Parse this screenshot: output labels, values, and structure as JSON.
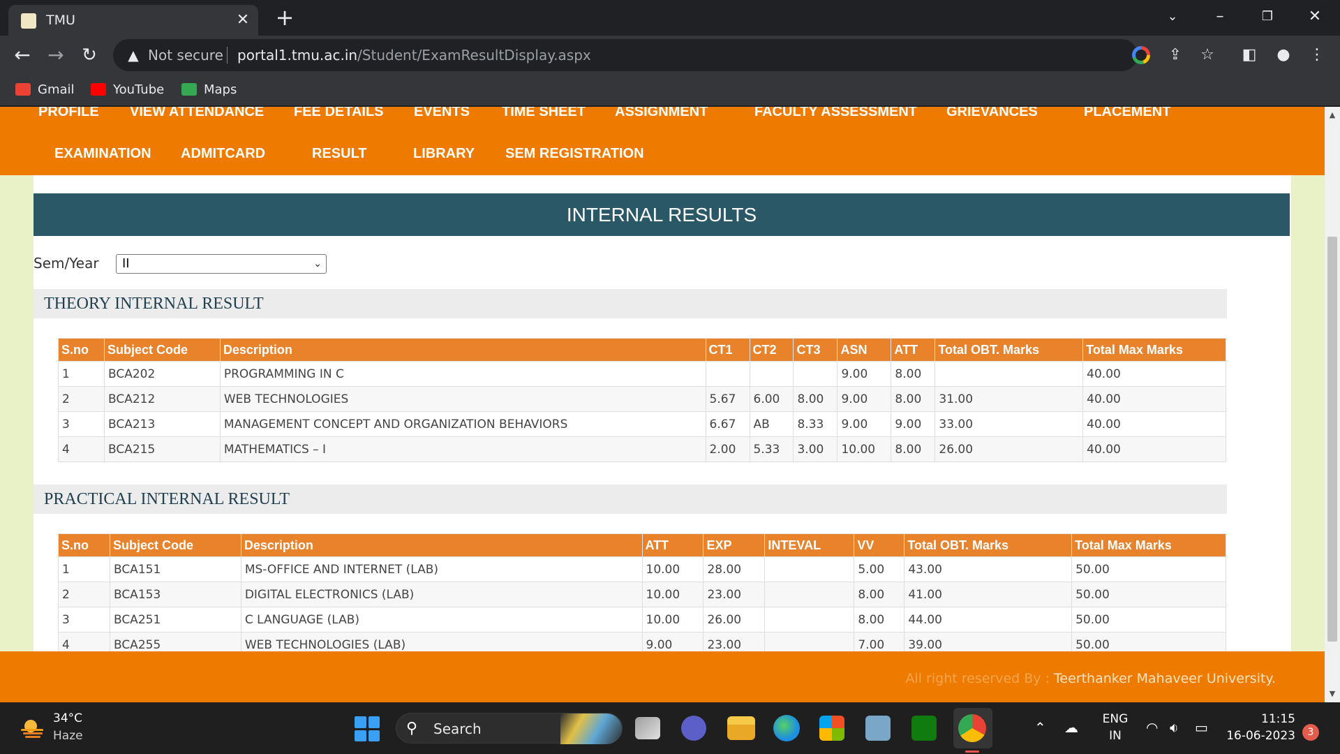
{
  "browser": {
    "tab_title": "TMU",
    "security_label": "Not secure",
    "url_host": "portal1.tmu.ac.in",
    "url_path": "/Student/ExamResultDisplay.aspx",
    "bookmarks": [
      {
        "label": "Gmail",
        "icon": "gmail-icon",
        "color": "#ea4335"
      },
      {
        "label": "YouTube",
        "icon": "youtube-icon",
        "color": "#ff0000"
      },
      {
        "label": "Maps",
        "icon": "maps-icon",
        "color": "#34a853"
      }
    ]
  },
  "menu": {
    "row1": [
      "PROFILE",
      "VIEW ATTENDANCE",
      "FEE DETAILS",
      "EVENTS",
      "TIME SHEET",
      "ASSIGNMENT",
      "FACULTY ASSESSMENT",
      "GRIEVANCES",
      "PLACEMENT"
    ],
    "row2": [
      "EXAMINATION",
      "ADMITCARD",
      "RESULT",
      "LIBRARY",
      "SEM REGISTRATION"
    ]
  },
  "page": {
    "header": "INTERNAL RESULTS",
    "sem_label": "Sem/Year",
    "sem_value": "II"
  },
  "theory": {
    "title": "THEORY INTERNAL RESULT",
    "columns": [
      "S.no",
      "Subject Code",
      "Description",
      "CT1",
      "CT2",
      "CT3",
      "ASN",
      "ATT",
      "Total OBT. Marks",
      "Total Max Marks"
    ],
    "rows": [
      [
        "1",
        "BCA202",
        "PROGRAMMING IN C",
        "",
        "",
        "",
        "9.00",
        "8.00",
        "",
        "40.00"
      ],
      [
        "2",
        "BCA212",
        "WEB TECHNOLOGIES",
        "5.67",
        "6.00",
        "8.00",
        "9.00",
        "8.00",
        "31.00",
        "40.00"
      ],
      [
        "3",
        "BCA213",
        "MANAGEMENT CONCEPT AND ORGANIZATION BEHAVIORS",
        "6.67",
        "AB",
        "8.33",
        "9.00",
        "9.00",
        "33.00",
        "40.00"
      ],
      [
        "4",
        "BCA215",
        "MATHEMATICS – I",
        "2.00",
        "5.33",
        "3.00",
        "10.00",
        "8.00",
        "26.00",
        "40.00"
      ]
    ]
  },
  "practical": {
    "title": "PRACTICAL INTERNAL RESULT",
    "columns": [
      "S.no",
      "Subject Code",
      "Description",
      "ATT",
      "EXP",
      "INTEVAL",
      "VV",
      "Total OBT. Marks",
      "Total Max Marks"
    ],
    "rows": [
      [
        "1",
        "BCA151",
        "MS-OFFICE AND INTERNET (LAB)",
        "10.00",
        "28.00",
        "",
        "5.00",
        "43.00",
        "50.00"
      ],
      [
        "2",
        "BCA153",
        "DIGITAL ELECTRONICS (LAB)",
        "10.00",
        "23.00",
        "",
        "8.00",
        "41.00",
        "50.00"
      ],
      [
        "3",
        "BCA251",
        "C LANGUAGE (LAB)",
        "10.00",
        "26.00",
        "",
        "8.00",
        "44.00",
        "50.00"
      ],
      [
        "4",
        "BCA255",
        "WEB TECHNOLOGIES (LAB)",
        "9.00",
        "23.00",
        "",
        "7.00",
        "39.00",
        "50.00"
      ]
    ]
  },
  "footer": {
    "prefix": "All right reserved By : ",
    "name": "Teerthanker Mahaveer University."
  },
  "taskbar": {
    "temp": "34°C",
    "condition": "Haze",
    "search": "Search",
    "lang1": "ENG",
    "lang2": "IN",
    "time": "11:15",
    "date": "16-06-2023",
    "badge": "3"
  },
  "colors": {
    "accent_orange": "#ef7a00",
    "table_header": "#e8822b",
    "results_header": "#2b5866",
    "page_bg": "#e8f2c6"
  }
}
